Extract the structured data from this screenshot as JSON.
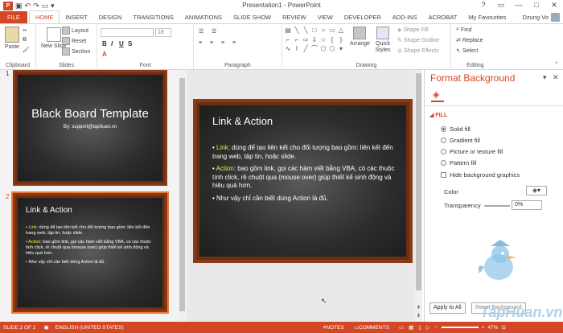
{
  "window": {
    "title": "Presentation1 - PowerPoint",
    "controls": [
      "?",
      "▭",
      "—",
      "□",
      "✕"
    ]
  },
  "tabs": [
    "FILE",
    "HOME",
    "INSERT",
    "DESIGN",
    "TRANSITIONS",
    "ANIMATIONS",
    "SLIDE SHOW",
    "REVIEW",
    "VIEW",
    "DEVELOPER",
    "ADD-INS",
    "ACROBAT",
    "My Favourites"
  ],
  "user": "Dzung Vo",
  "ribbon": {
    "clipboard": {
      "label": "Clipboard",
      "paste": "Paste"
    },
    "slides": {
      "label": "Slides",
      "new_slide": "New Slide",
      "layout": "Layout",
      "reset": "Reset",
      "section": "Section"
    },
    "font": {
      "label": "Font",
      "size": "18"
    },
    "paragraph": {
      "label": "Paragraph"
    },
    "drawing": {
      "label": "Drawing",
      "arrange": "Arrange",
      "quick_styles": "Quick Styles",
      "shape_fill": "Shape Fill",
      "shape_outline": "Shape Outline",
      "shape_effects": "Shape Effects"
    },
    "editing": {
      "label": "Editing",
      "find": "Find",
      "replace": "Replace",
      "select": "Select"
    }
  },
  "thumbnails": [
    {
      "num": "1",
      "title": "Black Board Template",
      "subtitle": "By: support@taphuan.vn"
    },
    {
      "num": "2",
      "title": "Link & Action",
      "items": [
        {
          "hl": "Link",
          "text": ": dùng để tạo liên kết cho đối tượng bao gồm: liên kết đến trang web, tập tin, hoặc slide."
        },
        {
          "hl": "Action",
          "text": ": bao gồm link, gọi các hàm viết bằng VBA, có các thuộc tính click, rê chuột qua (mouse over) giúp thiết kế sinh động và hiệu quả hơn."
        },
        {
          "hl": "",
          "text": "Như vậy chỉ cần biết dùng Action là đủ."
        }
      ]
    }
  ],
  "slide": {
    "title": "Link & Action",
    "items": [
      {
        "hl": "Link",
        "text": ": dùng để tạo liên kết cho đối tượng bao gồm: liên kết đến trang web, tập tin, hoặc slide."
      },
      {
        "hl": "Action",
        "text": ": bao gồm link, gọi các hàm viết bằng VBA, có các thuộc tính click, rê chuột qua (mouse over) giúp thiết kế sinh động và hiệu quả hơn."
      },
      {
        "hl": "",
        "text": "Như vậy chỉ cần biết dùng Action là đủ."
      }
    ]
  },
  "format_pane": {
    "title": "Format Background",
    "section": "FILL",
    "options": [
      "Solid fill",
      "Gradient fill",
      "Picture or texture fill",
      "Pattern fill"
    ],
    "hide_graphics": "Hide background graphics",
    "color_label": "Color",
    "transparency_label": "Transparency",
    "transparency_value": "0%",
    "apply_all": "Apply to All",
    "reset": "Reset Background"
  },
  "status": {
    "slide": "SLIDE 2 OF 2",
    "language": "ENGLISH (UNITED STATES)",
    "notes": "NOTES",
    "comments": "COMMENTS",
    "zoom": "47%"
  },
  "watermark": "TapHuan.vn",
  "colors": {
    "accent": "#d24726",
    "highlight": "#f5e642",
    "frame": "#8b3a16"
  }
}
